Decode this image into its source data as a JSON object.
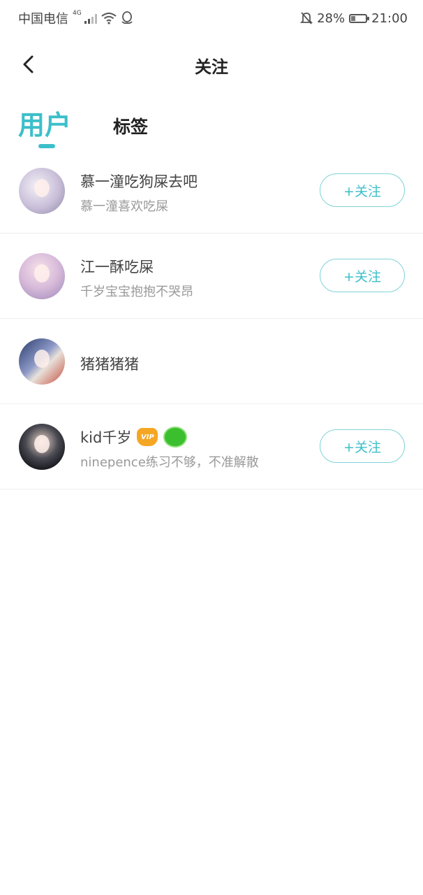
{
  "status_bar": {
    "carrier": "中国电信",
    "network": "4G",
    "battery_percent": "28%",
    "battery_level": 0.28,
    "time": "21:00"
  },
  "nav": {
    "title": "关注",
    "back_icon": "chevron-left-icon"
  },
  "tabs": [
    {
      "label": "用户",
      "active": true
    },
    {
      "label": "标签",
      "active": false
    }
  ],
  "users": [
    {
      "name": "慕一潼吃狗屎去吧",
      "desc": "慕一潼喜欢吃屎",
      "follow_label": "+关注"
    },
    {
      "name": "江一酥吃屎",
      "desc": "千岁宝宝抱抱不哭昂",
      "follow_label": "+关注"
    },
    {
      "name": "猪猪猪猪"
    },
    {
      "name": "kid千岁",
      "desc": "ninepence练习不够，不准解散",
      "follow_label": "+关注",
      "badges": {
        "vip": "VIP",
        "green": "推出\n用户"
      }
    }
  ],
  "colors": {
    "accent": "#3cbfca",
    "follow_border": "#7fd3d9",
    "text_primary": "#444444",
    "text_secondary": "#999999"
  }
}
